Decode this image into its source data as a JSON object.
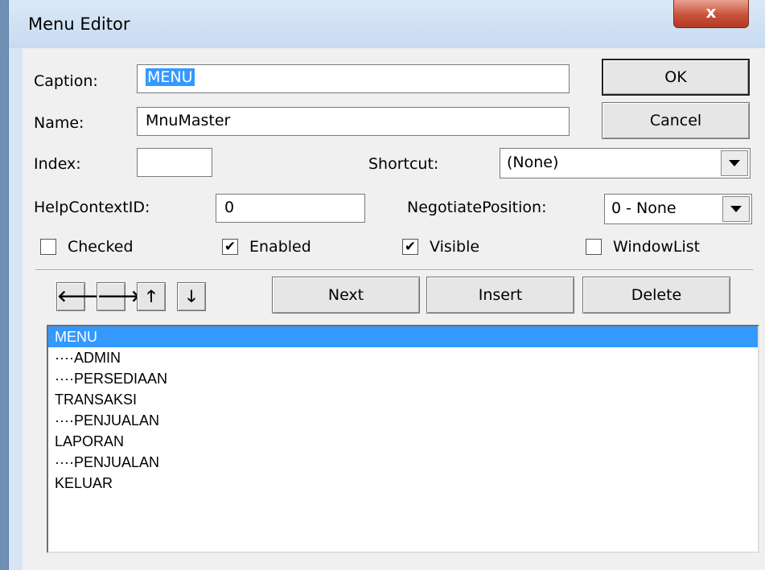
{
  "window": {
    "title": "Menu Editor",
    "close_glyph": "x"
  },
  "caption": {
    "label": "Caption:",
    "value": "MENU"
  },
  "name": {
    "label": "Name:",
    "value": "MnuMaster"
  },
  "index": {
    "label": "Index:",
    "value": ""
  },
  "shortcut": {
    "label": "Shortcut:",
    "value": "(None)"
  },
  "help_context": {
    "label": "HelpContextID:",
    "value": "0"
  },
  "negotiate_position": {
    "label": "NegotiatePosition:",
    "value": "0 - None"
  },
  "checkboxes": {
    "checked": {
      "label": "Checked",
      "state": false
    },
    "enabled": {
      "label": "Enabled",
      "state": true
    },
    "visible": {
      "label": "Visible",
      "state": true
    },
    "window_list": {
      "label": "WindowList",
      "state": false
    }
  },
  "buttons": {
    "ok": "OK",
    "cancel": "Cancel",
    "next": "Next",
    "insert": "Insert",
    "delete": "Delete",
    "move_left": "🡐",
    "move_right": "🡒",
    "move_up": "🡑",
    "move_down": "🡓"
  },
  "icons": [
    "close-icon",
    "arrow-left-icon",
    "arrow-right-icon",
    "arrow-up-icon",
    "arrow-down-icon",
    "dropdown-arrow-icon",
    "checkmark-icon"
  ],
  "menu_items": [
    {
      "text": "MENU",
      "selected": true
    },
    {
      "text": "····ADMIN",
      "selected": false
    },
    {
      "text": "····PERSEDIAAN",
      "selected": false
    },
    {
      "text": "TRANSAKSI",
      "selected": false
    },
    {
      "text": "····PENJUALAN",
      "selected": false
    },
    {
      "text": "LAPORAN",
      "selected": false
    },
    {
      "text": "····PENJUALAN",
      "selected": false
    },
    {
      "text": "KELUAR",
      "selected": false
    }
  ],
  "colors": {
    "selection": "#3399ff",
    "title_bar": "#c7dbf1",
    "close_button": "#c8523a"
  }
}
